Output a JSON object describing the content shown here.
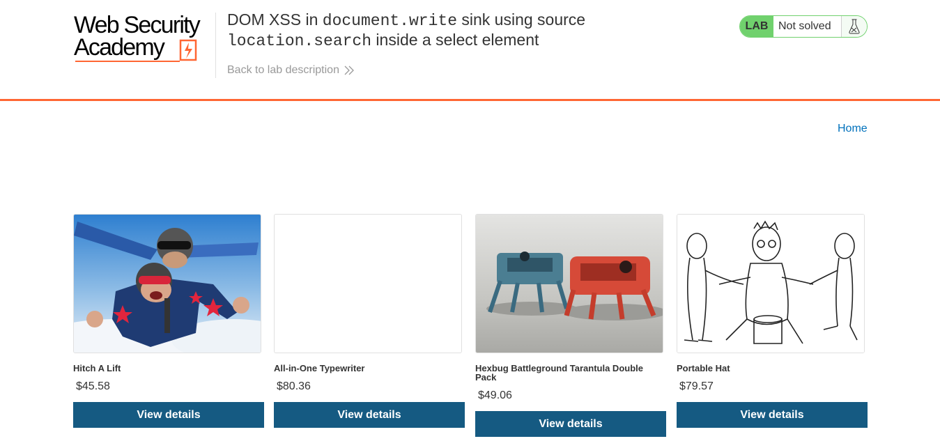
{
  "header": {
    "logo": {
      "line1": "Web Security",
      "line2": "Academy"
    },
    "title_parts": {
      "t1": "DOM XSS in ",
      "code1": "document.write",
      "t2": " sink using source",
      "code2": "location.search",
      "t3": " inside a select element"
    },
    "back_link": "Back to lab description",
    "lab_badge": "LAB",
    "lab_status": "Not solved",
    "colors": {
      "accent": "#ff6633",
      "lab_green": "#70d16d",
      "button_blue": "#155a82",
      "link_blue": "#0071bc"
    }
  },
  "nav": {
    "home": "Home"
  },
  "products": [
    {
      "name": "Hitch A Lift",
      "price": "$45.58",
      "button": "View details",
      "image": "skydiving-photo"
    },
    {
      "name": "All-in-One Typewriter",
      "price": "$80.36",
      "button": "View details",
      "image": "blank-image"
    },
    {
      "name": "Hexbug Battleground Tarantula Double Pack",
      "price": "$49.06",
      "button": "View details",
      "image": "robot-spiders-photo"
    },
    {
      "name": "Portable Hat",
      "price": "$79.57",
      "button": "View details",
      "image": "cartoon-drawing"
    }
  ]
}
